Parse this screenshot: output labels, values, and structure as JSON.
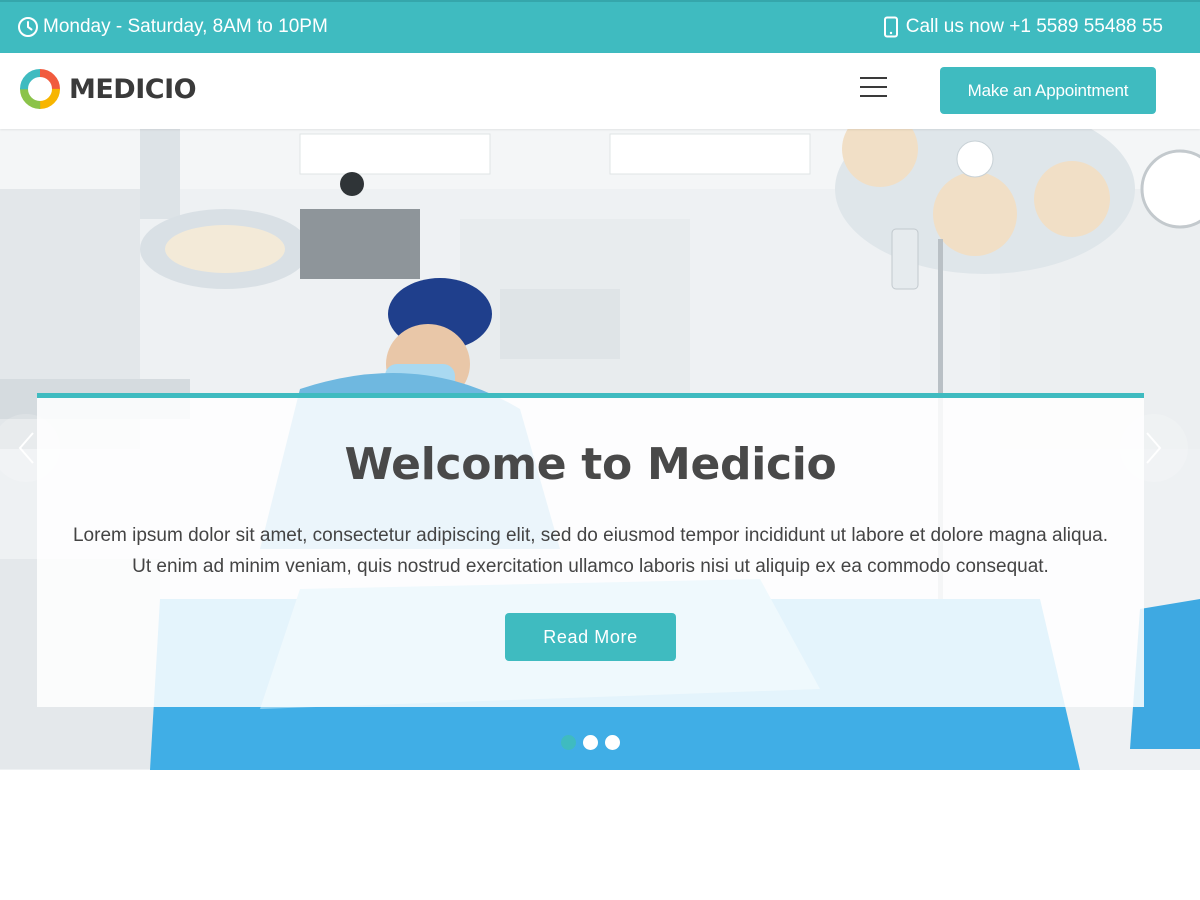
{
  "topbar": {
    "hours": "Monday - Saturday, 8AM to 10PM",
    "phone": "Call us now +1 5589 55488 55",
    "background": "#3fbbc0"
  },
  "header": {
    "logo_text": "MEDICIO",
    "menu_icon": "hamburger-icon",
    "appointment_label": "Make an Appointment"
  },
  "hero": {
    "title": "Welcome to Medicio",
    "text_line1": "Lorem ipsum dolor sit amet, consectetur adipiscing elit, sed do eiusmod tempor incididunt ut labore et dolore magna aliqua.",
    "text_line2": "Ut enim ad minim veniam, quis nostrud exercitation ullamco laboris nisi ut aliquip ex ea commodo consequat.",
    "button_label": "Read More",
    "prev_icon": "chevron-left-icon",
    "next_icon": "chevron-right-icon",
    "slides": 3,
    "active_slide": 1
  },
  "colors": {
    "accent": "#3fbbc0",
    "heading": "#494949",
    "body_text": "#444444"
  }
}
